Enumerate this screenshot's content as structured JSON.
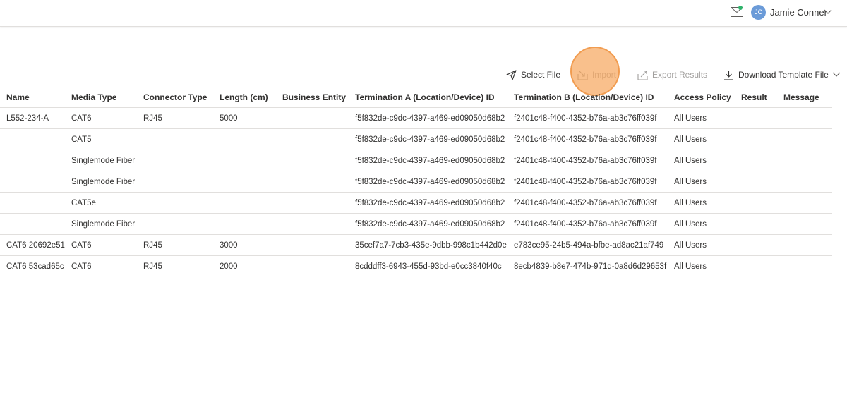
{
  "header": {
    "user_initials": "JC",
    "user_name": "Jamie Conner",
    "notification_color": "#2fb36b",
    "avatar_color": "#6b9bd8"
  },
  "toolbar": {
    "select_file": "Select File",
    "import": "Import",
    "export_results": "Export Results",
    "download_template": "Download Template File"
  },
  "table": {
    "columns": [
      "Name",
      "Media Type",
      "Connector Type",
      "Length (cm)",
      "Business Entity",
      "Termination A (Location/Device) ID",
      "Termination B (Location/Device) ID",
      "Access Policy",
      "Result",
      "Message"
    ],
    "rows": [
      [
        "L552-234-A",
        "CAT6",
        "RJ45",
        "5000",
        "",
        "f5f832de-c9dc-4397-a469-ed09050d68b2",
        "f2401c48-f400-4352-b76a-ab3c76ff039f",
        "All Users",
        "",
        ""
      ],
      [
        "",
        "CAT5",
        "",
        "",
        "",
        "f5f832de-c9dc-4397-a469-ed09050d68b2",
        "f2401c48-f400-4352-b76a-ab3c76ff039f",
        "All Users",
        "",
        ""
      ],
      [
        "",
        "Singlemode Fiber",
        "",
        "",
        "",
        "f5f832de-c9dc-4397-a469-ed09050d68b2",
        "f2401c48-f400-4352-b76a-ab3c76ff039f",
        "All Users",
        "",
        ""
      ],
      [
        "",
        "Singlemode Fiber",
        "",
        "",
        "",
        "f5f832de-c9dc-4397-a469-ed09050d68b2",
        "f2401c48-f400-4352-b76a-ab3c76ff039f",
        "All Users",
        "",
        ""
      ],
      [
        "",
        "CAT5e",
        "",
        "",
        "",
        "f5f832de-c9dc-4397-a469-ed09050d68b2",
        "f2401c48-f400-4352-b76a-ab3c76ff039f",
        "All Users",
        "",
        ""
      ],
      [
        "",
        "Singlemode Fiber",
        "",
        "",
        "",
        "f5f832de-c9dc-4397-a469-ed09050d68b2",
        "f2401c48-f400-4352-b76a-ab3c76ff039f",
        "All Users",
        "",
        ""
      ],
      [
        "CAT6 20692e51",
        "CAT6",
        "RJ45",
        "3000",
        "",
        "35cef7a7-7cb3-435e-9dbb-998c1b442d0e",
        "e783ce95-24b5-494a-bfbe-ad8ac21af749",
        "All Users",
        "",
        ""
      ],
      [
        "CAT6 53cad65c",
        "CAT6",
        "RJ45",
        "2000",
        "",
        "8cdddff3-6943-455d-93bd-e0cc3840f40c",
        "8ecb4839-b8e7-474b-971d-0a8d6d29653f",
        "All Users",
        "",
        ""
      ]
    ]
  }
}
